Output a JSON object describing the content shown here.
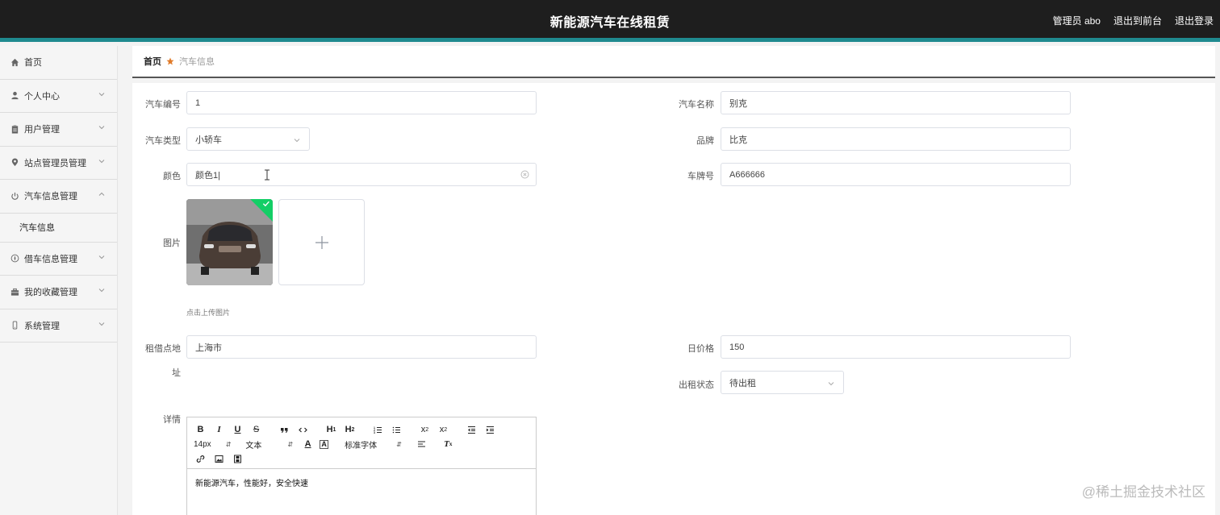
{
  "header": {
    "title": "新能源汽车在线租赁",
    "admin_label": "管理员 abo",
    "back_to_front": "退出到前台",
    "logout": "退出登录"
  },
  "sidebar": {
    "items": [
      {
        "label": "首页",
        "icon": "home-icon"
      },
      {
        "label": "个人中心",
        "icon": "user-icon"
      },
      {
        "label": "用户管理",
        "icon": "clipboard-icon"
      },
      {
        "label": "站点管理员管理",
        "icon": "map-pin-icon"
      },
      {
        "label": "汽车信息管理",
        "icon": "power-icon",
        "expanded": true
      },
      {
        "label": "借车信息管理",
        "icon": "compass-icon"
      },
      {
        "label": "我的收藏管理",
        "icon": "briefcase-icon"
      },
      {
        "label": "系统管理",
        "icon": "phone-icon"
      }
    ],
    "submenu": [
      "汽车信息"
    ]
  },
  "breadcrumb": {
    "home": "首页",
    "current": "汽车信息"
  },
  "form": {
    "car_no": {
      "label": "汽车编号",
      "value": "1"
    },
    "car_name": {
      "label": "汽车名称",
      "value": "别克"
    },
    "car_type": {
      "label": "汽车类型",
      "value": "小轿车"
    },
    "brand": {
      "label": "品牌",
      "value": "比克"
    },
    "color": {
      "label": "颜色",
      "value": "颜色1|"
    },
    "plate": {
      "label": "车牌号",
      "value": "A666666"
    },
    "image": {
      "label": "图片",
      "hint": "点击上传图片"
    },
    "address": {
      "label_line1": "租借点地",
      "label_line2": "址",
      "value": "上海市"
    },
    "daily_price": {
      "label": "日价格",
      "value": "150"
    },
    "rent_status": {
      "label": "出租状态",
      "value": "待出租"
    },
    "details": {
      "label": "详情",
      "font_size": "14px",
      "text_type": "文本",
      "font_family": "标准字体",
      "content": "新能源汽车，性能好，安全快速"
    }
  },
  "watermark": "@稀土掘金技术社区"
}
